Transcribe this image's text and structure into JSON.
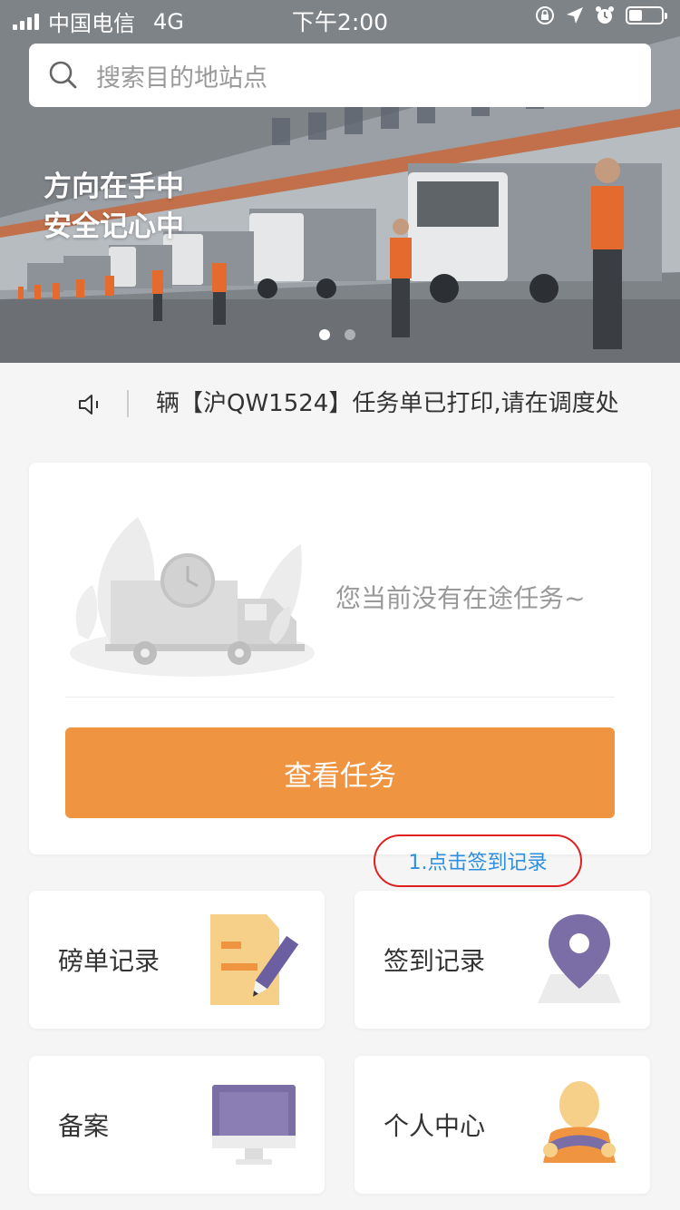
{
  "status_bar": {
    "carrier": "中国电信",
    "network": "4G",
    "time": "下午2:00"
  },
  "search": {
    "placeholder": "搜索目的地站点"
  },
  "banner": {
    "slogan_line1": "方向在手中",
    "slogan_line2": "安全记心中",
    "slide_count": 2,
    "active_slide": 1
  },
  "notice": {
    "text": "辆【沪QW1524】任务单已打印,请在调度处"
  },
  "task_card": {
    "empty_text": "您当前没有在途任务~",
    "button_label": "查看任务"
  },
  "annotation": {
    "text": "1.点击签到记录",
    "color": "#e02020"
  },
  "tiles": [
    {
      "label": "磅单记录",
      "icon": "document-pen-icon"
    },
    {
      "label": "签到记录",
      "icon": "location-pin-icon"
    },
    {
      "label": "备案",
      "icon": "monitor-icon"
    },
    {
      "label": "个人中心",
      "icon": "driver-avatar-icon"
    }
  ],
  "colors": {
    "accent": "#ef9441",
    "pin": "#7b6ea7"
  }
}
